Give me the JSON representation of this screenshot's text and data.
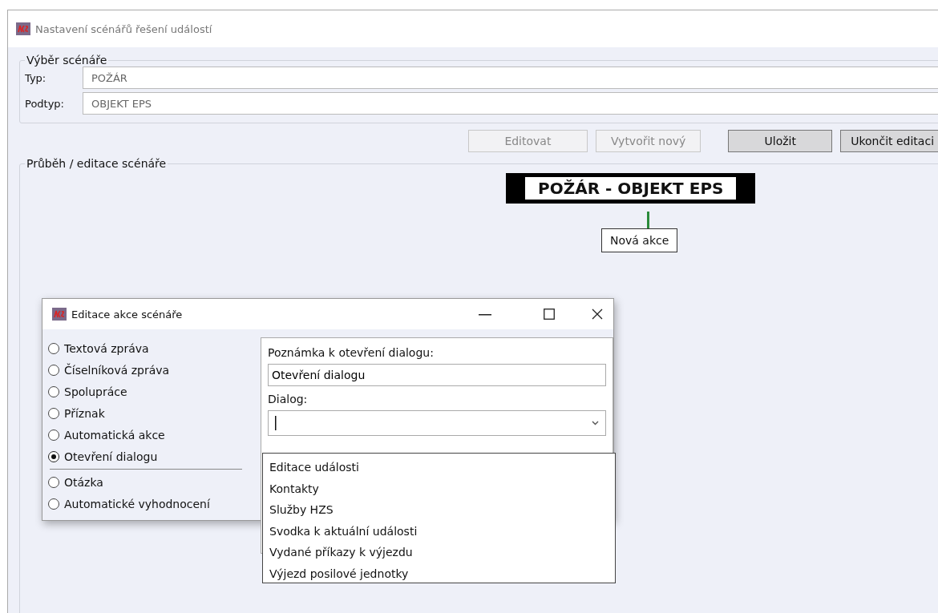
{
  "window": {
    "title": "Nastavení scénářů řešení událostí"
  },
  "scenario_selection": {
    "title": "Výběr scénáře",
    "fields": [
      {
        "label": "Typ:",
        "value": "POŽÁR"
      },
      {
        "label": "Podtyp:",
        "value": "OBJEKT EPS"
      }
    ]
  },
  "buttons": [
    {
      "label": "Editovat",
      "disabled": true
    },
    {
      "label": "Vytvořit nový",
      "disabled": true
    },
    {
      "label": "Uložit",
      "disabled": false
    },
    {
      "label": "Ukončit editaci",
      "disabled": false
    }
  ],
  "progress": {
    "title": "Průběh / editace scénáře",
    "root_node": "POŽÁR - OBJEKT EPS",
    "child_node": "Nová akce"
  },
  "dialog": {
    "title": "Editace akce scénáře",
    "option_groups": [
      [
        {
          "label": "Textová zpráva",
          "selected": false
        },
        {
          "label": "Číselníková zpráva",
          "selected": false
        },
        {
          "label": "Spolupráce",
          "selected": false
        },
        {
          "label": "Příznak",
          "selected": false
        },
        {
          "label": "Automatická akce",
          "selected": false
        },
        {
          "label": "Otevření dialogu",
          "selected": true
        }
      ],
      [
        {
          "label": "Otázka",
          "selected": false
        },
        {
          "label": "Automatické vyhodnocení",
          "selected": false
        }
      ]
    ],
    "note_label": "Poznámka k otevření dialogu:",
    "note_value": "Otevření dialogu",
    "dialog_label": "Dialog:",
    "dropdown_items": [
      "Editace události",
      "Kontakty",
      "Služby HZS",
      "Svodka k aktuální události",
      "Vydané příkazy k výjezdu",
      "Výjezd posilové jednotky"
    ]
  }
}
